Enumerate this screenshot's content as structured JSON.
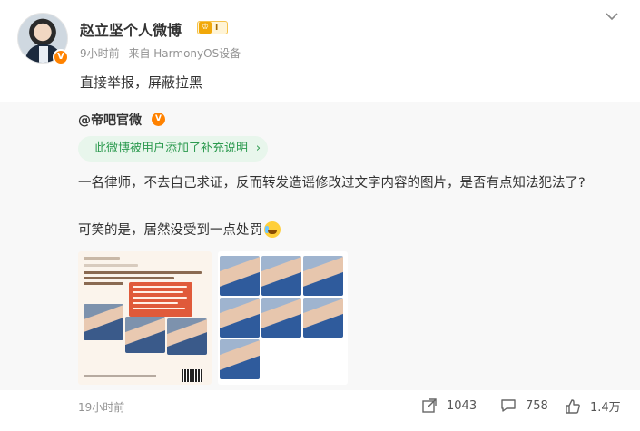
{
  "author": {
    "name": "赵立坚个人微博",
    "level_label": "I",
    "time": "9小时前",
    "source": "来自 HarmonyOS设备"
  },
  "post": {
    "text": "直接举报，屏蔽拉黑"
  },
  "repost": {
    "author": "@帝吧官微",
    "note_pill": "此微博被用户添加了补充说明",
    "text": "一名律师，不去自己求证，反而转发造谣修改过文字内容的图片，是否有点知法犯法了?",
    "text2": "可笑的是，居然没受到一点处罚"
  },
  "footer": {
    "time": "19小时前",
    "reposts": "1043",
    "comments": "758",
    "likes": "1.4万"
  },
  "colors": {
    "accent_orange": "#ff8200",
    "note_green": "#2c9a4f",
    "muted_text": "#939393"
  },
  "icons": {
    "more": "chevron-down-icon",
    "repost": "repost-icon",
    "comment": "comment-icon",
    "like": "thumbs-up-icon"
  }
}
